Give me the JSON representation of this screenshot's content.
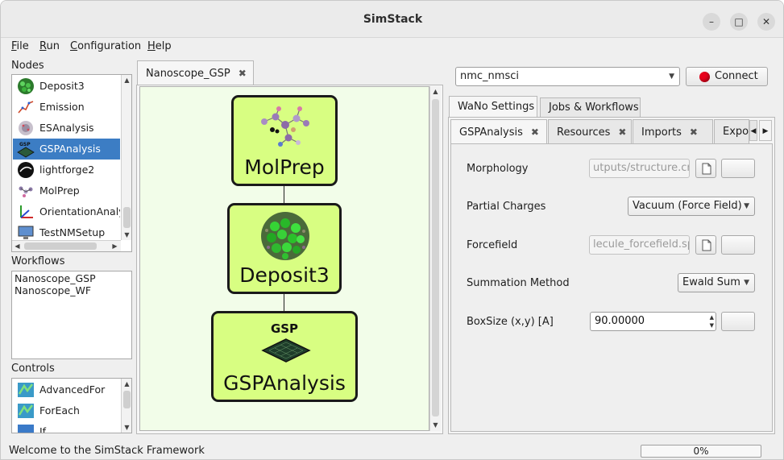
{
  "window": {
    "title": "SimStack",
    "minimize": "–",
    "maximize": "□",
    "close": "✕"
  },
  "menu": [
    {
      "label": "File",
      "ul": "F",
      "rest": "ile"
    },
    {
      "label": "Run",
      "ul": "R",
      "rest": "un"
    },
    {
      "label": "Configuration",
      "ul": "C",
      "rest": "onfiguration"
    },
    {
      "label": "Help",
      "ul": "H",
      "rest": "elp"
    }
  ],
  "nodes_panel": {
    "title": "Nodes",
    "items": [
      "Deposit3",
      "Emission",
      "ESAnalysis",
      "GSPAnalysis",
      "lightforge2",
      "MolPrep",
      "OrientationAnaly",
      "TestNMSetup"
    ],
    "selected": "GSPAnalysis"
  },
  "workflows_panel": {
    "title": "Workflows",
    "items": [
      "Nanoscope_GSP",
      "Nanoscope_WF"
    ]
  },
  "controls_panel": {
    "title": "Controls",
    "items": [
      "AdvancedFor",
      "ForEach",
      "If"
    ]
  },
  "editor": {
    "tab": "Nanoscope_GSP",
    "nodes": [
      {
        "label": "MolPrep"
      },
      {
        "label": "Deposit3"
      },
      {
        "label": "GSPAnalysis",
        "badge": "GSP"
      }
    ]
  },
  "server": {
    "selected": "nmc_nmsci",
    "connect_label": "Connect",
    "status_color": "#e8001c"
  },
  "right_tabs": [
    "WaNo Settings",
    "Jobs & Workflows"
  ],
  "wano_tabs": [
    "GSPAnalysis",
    "Resources",
    "Imports",
    "Expo"
  ],
  "params": {
    "morphology": {
      "label": "Morphology",
      "value": "utputs/structure.cml"
    },
    "partial_charges": {
      "label": "Partial Charges",
      "value": "Vacuum (Force Field)"
    },
    "forcefield": {
      "label": "Forcefield",
      "value": "lecule_forcefield.spf"
    },
    "summation": {
      "label": "Summation Method",
      "value": "Ewald Sum"
    },
    "boxsize": {
      "label": "BoxSize (x,y) [A]",
      "value": "90.00000"
    }
  },
  "status": {
    "message": "Welcome to the SimStack Framework",
    "progress": "0%"
  }
}
